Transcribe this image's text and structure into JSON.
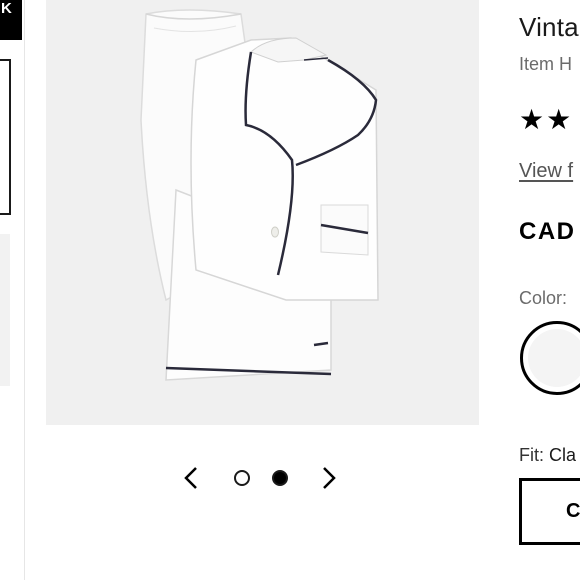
{
  "rail": {
    "back_label": "K",
    "thumbnails": [
      "thumbnail-1",
      "thumbnail-2"
    ]
  },
  "carousel": {
    "prev_icon": "chevron-left-icon",
    "next_icon": "chevron-right-icon",
    "dots": [
      {
        "active": false
      },
      {
        "active": true
      }
    ]
  },
  "product": {
    "title": "Vinta",
    "item_number": "Item H",
    "rating_stars": "★★",
    "view_link": "View f",
    "price": "CAD",
    "color_label": "Color:",
    "fit_label": "Fit:",
    "fit_value": "Cla",
    "fit_button_label": "Cl"
  },
  "colors": {
    "accent": "#000000",
    "image_background": "#f0f0f0",
    "muted_text": "#6b6b6b"
  }
}
